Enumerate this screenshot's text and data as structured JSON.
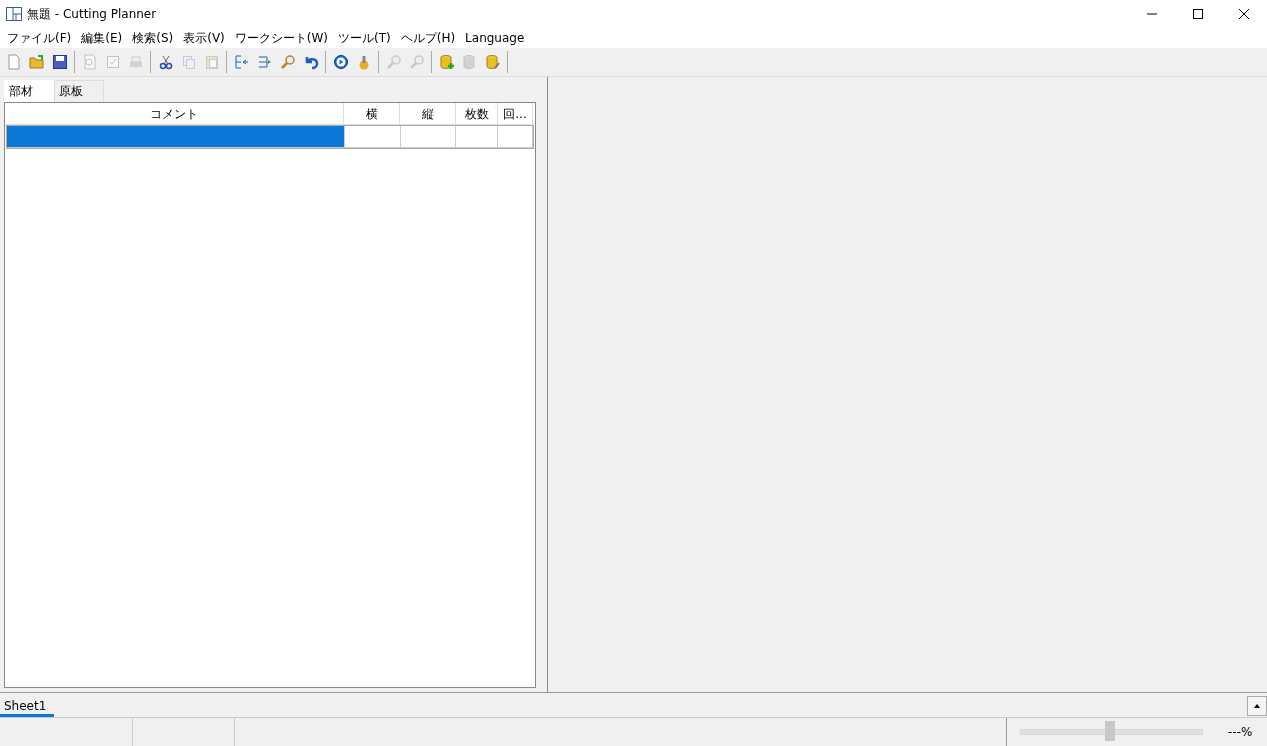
{
  "window": {
    "title": "無題 - Cutting Planner"
  },
  "menu": [
    "ファイル(F)",
    "編集(E)",
    "検索(S)",
    "表示(V)",
    "ワークシート(W)",
    "ツール(T)",
    "ヘルプ(H)",
    "Language"
  ],
  "toolbar": [
    [
      {
        "kind": "new",
        "disabled": false
      },
      {
        "kind": "open",
        "disabled": false
      },
      {
        "kind": "save",
        "disabled": false
      }
    ],
    [
      {
        "kind": "preview",
        "disabled": true
      },
      {
        "kind": "check",
        "disabled": true
      },
      {
        "kind": "print",
        "disabled": true
      }
    ],
    [
      {
        "kind": "cut",
        "disabled": false
      },
      {
        "kind": "copy",
        "disabled": true
      },
      {
        "kind": "paste",
        "disabled": true
      }
    ],
    [
      {
        "kind": "indent-left",
        "disabled": false
      },
      {
        "kind": "indent-right",
        "disabled": false
      },
      {
        "kind": "find",
        "disabled": false
      },
      {
        "kind": "undo",
        "disabled": false
      }
    ],
    [
      {
        "kind": "run",
        "disabled": false
      },
      {
        "kind": "settings",
        "disabled": false
      }
    ],
    [
      {
        "kind": "zoom-in",
        "disabled": true
      },
      {
        "kind": "zoom-out",
        "disabled": true
      }
    ],
    [
      {
        "kind": "db-add",
        "disabled": false
      },
      {
        "kind": "db",
        "disabled": true
      },
      {
        "kind": "db-tool",
        "disabled": false
      }
    ]
  ],
  "panel_tabs": [
    {
      "label": "部材",
      "selected": true
    },
    {
      "label": "原板",
      "selected": false
    }
  ],
  "table": {
    "columns": [
      "コメント",
      "横",
      "縦",
      "枚数",
      "回..."
    ],
    "rows": [
      {
        "cells": [
          "",
          "",
          "",
          "",
          ""
        ],
        "selected": true
      }
    ]
  },
  "sheet_tabs": [
    {
      "label": "Sheet1",
      "selected": true
    }
  ],
  "status_bar": {
    "zoom": {
      "level": 0.49,
      "reading": "---%"
    }
  }
}
